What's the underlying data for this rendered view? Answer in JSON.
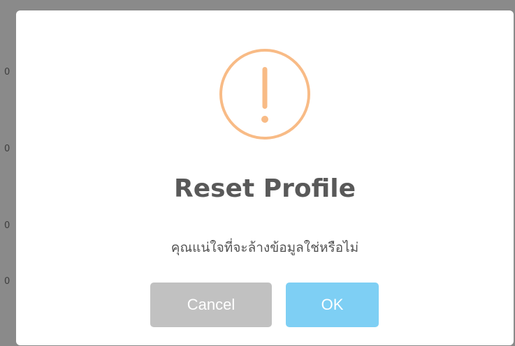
{
  "background": {
    "fragments": [
      "0",
      "0",
      "0",
      "0"
    ]
  },
  "dialog": {
    "icon": "exclamation-warning-icon",
    "icon_color": "#f8bb86",
    "title": "Reset Profile",
    "message": "คุณแน่ใจที่จะล้างข้อมูลใช่หรือไม่",
    "cancel_label": "Cancel",
    "ok_label": "OK",
    "cancel_color": "#c1c1c1",
    "ok_color": "#7ecff4"
  }
}
